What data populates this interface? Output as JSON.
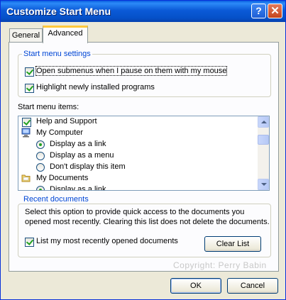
{
  "window": {
    "title": "Customize Start Menu",
    "help_label": "?",
    "close_label": "✕"
  },
  "tabs": [
    {
      "label": "General"
    },
    {
      "label": "Advanced"
    }
  ],
  "settings": {
    "group_label": "Start menu settings",
    "opt1": "Open submenus when I pause on them with my mouse",
    "opt2": "Highlight newly installed programs"
  },
  "items": {
    "label": "Start menu items:",
    "entries": [
      {
        "label": "Help and Support",
        "kind": "checkbox",
        "checked": true
      },
      {
        "label": "My Computer",
        "kind": "header",
        "icon": "computer-icon"
      },
      {
        "label": "Display as a link",
        "kind": "radio",
        "selected": true
      },
      {
        "label": "Display as a menu",
        "kind": "radio",
        "selected": false
      },
      {
        "label": "Don't display this item",
        "kind": "radio",
        "selected": false
      },
      {
        "label": "My Documents",
        "kind": "header",
        "icon": "folder-icon"
      },
      {
        "label": "Display as a link",
        "kind": "radio",
        "selected": true
      }
    ]
  },
  "recent": {
    "group_label": "Recent documents",
    "desc_line1": "Select this option to provide quick access to the documents you",
    "desc_line2": "opened most recently.  Clearing this list does not delete the documents.",
    "list_option": "List my most recently opened documents",
    "clear_button": "Clear List"
  },
  "watermark": "Copyright: Perry Babin",
  "footer": {
    "ok": "OK",
    "cancel": "Cancel"
  },
  "colors": {
    "titlebar": "#0a5fe0",
    "group_label": "#0046d5",
    "check": "#21a121"
  }
}
